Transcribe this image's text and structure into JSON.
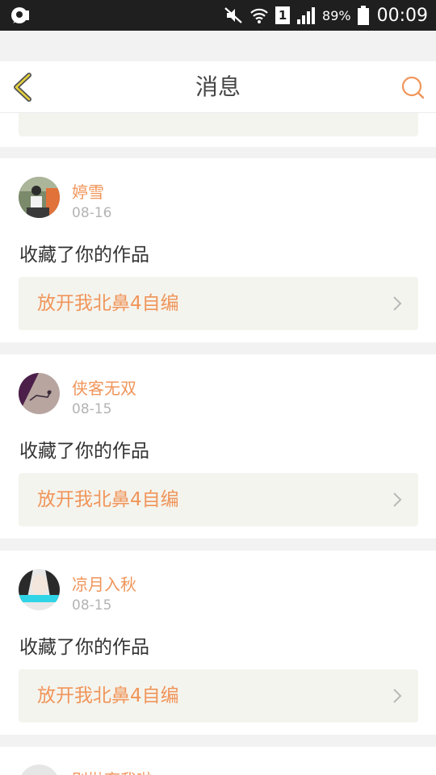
{
  "status_bar": {
    "battery": "89%",
    "sim": "1",
    "time": "00:09",
    "icons": [
      "notification-icon",
      "mute-icon",
      "wifi-icon",
      "sim-icon",
      "signal-icon",
      "battery-icon"
    ]
  },
  "header": {
    "title": "消息",
    "back_icon": "chevron-left-icon",
    "search_icon": "search-icon",
    "accent_color": "#f0955a"
  },
  "messages": [
    {
      "username": "婷雪",
      "date": "08-16",
      "action": "收藏了你的作品",
      "work_title": "放开我北鼻4自编"
    },
    {
      "username": "侠客无双",
      "date": "08-15",
      "action": "收藏了你的作品",
      "work_title": "放开我北鼻4自编"
    },
    {
      "username": "凉月入秋",
      "date": "08-15",
      "action": "收藏了你的作品",
      "work_title": "放开我北鼻4自编"
    },
    {
      "username": "别抛弃我啦"
    }
  ]
}
